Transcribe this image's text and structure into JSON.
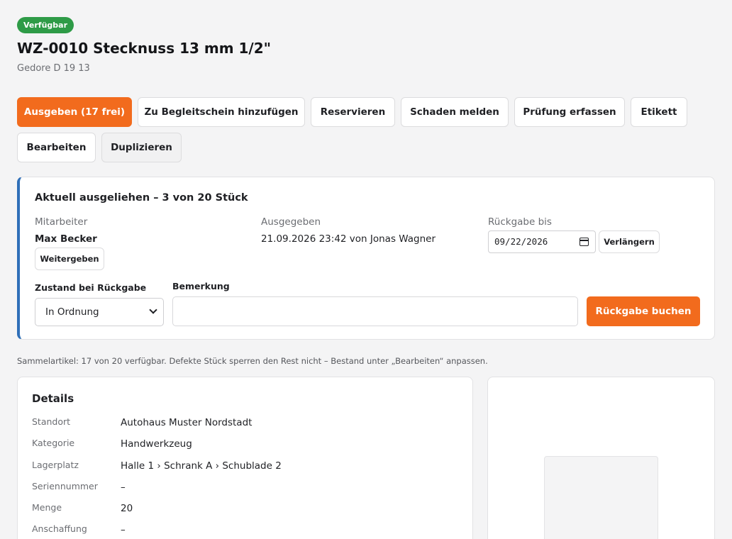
{
  "status_badge": "Verfügbar",
  "item": {
    "title": "WZ-0010 Stecknuss 13 mm 1/2\"",
    "subtitle": "Gedore D 19 13"
  },
  "actions": {
    "checkout": "Ausgeben (17 frei)",
    "add_to_slip": "Zu Begleitschein hinzufügen",
    "reserve": "Reservieren",
    "report_damage": "Schaden melden",
    "record_inspection": "Prüfung erfassen",
    "label": "Etikett",
    "edit": "Bearbeiten",
    "duplicate": "Duplizieren"
  },
  "loan": {
    "title": "Aktuell ausgeliehen – 3 von 20 Stück",
    "employee_label": "Mitarbeiter",
    "employee": "Max Becker",
    "pass_on_button": "Weitergeben",
    "issued_label": "Ausgegeben",
    "issued_value": "21.09.2026 23:42 von Jonas Wagner",
    "return_label": "Rückgabe bis",
    "return_date": "09/22/2026",
    "extend_button": "Verlängern",
    "condition_label": "Zustand bei Rückgabe",
    "condition_value": "In Ordnung",
    "remark_label": "Bemerkung",
    "remark_value": "",
    "book_return_button": "Rückgabe buchen"
  },
  "note": "Sammelartikel: 17 von 20 verfügbar. Defekte Stück sperren den Rest nicht – Bestand unter „Bearbeiten“ anpassen.",
  "details": {
    "title": "Details",
    "rows": [
      {
        "key": "Standort",
        "value": "Autohaus Muster Nordstadt"
      },
      {
        "key": "Kategorie",
        "value": "Handwerkzeug"
      },
      {
        "key": "Lagerplatz",
        "value": "Halle 1 › Schrank A › Schublade 2"
      },
      {
        "key": "Seriennummer",
        "value": "–"
      },
      {
        "key": "Menge",
        "value": "20"
      },
      {
        "key": "Anschaffung",
        "value": "–"
      }
    ]
  },
  "colors": {
    "primary": "#f26b1d",
    "success": "#2e9b47",
    "loan_accent": "#2f6fb8"
  }
}
